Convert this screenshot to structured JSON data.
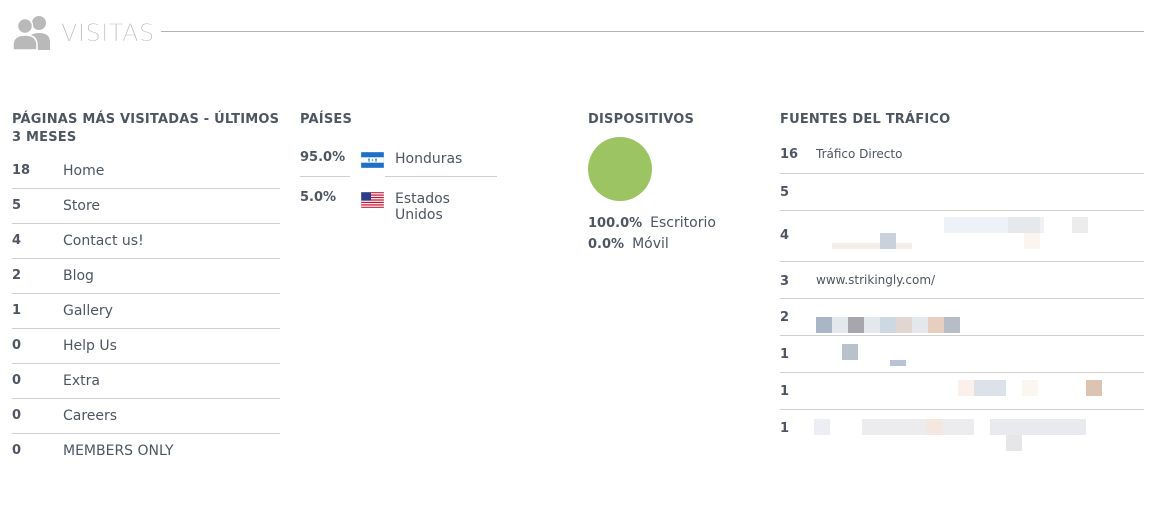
{
  "header": {
    "title": "VISITAS"
  },
  "pages": {
    "title": "PÁGINAS MÁS VISITADAS - ÚLTIMOS 3 MESES",
    "items": [
      {
        "count": "18",
        "name": "Home"
      },
      {
        "count": "5",
        "name": "Store"
      },
      {
        "count": "4",
        "name": "Contact us!"
      },
      {
        "count": "2",
        "name": "Blog"
      },
      {
        "count": "1",
        "name": "Gallery"
      },
      {
        "count": "0",
        "name": "Help Us"
      },
      {
        "count": "0",
        "name": "Extra"
      },
      {
        "count": "0",
        "name": "Careers"
      },
      {
        "count": "0",
        "name": "MEMBERS ONLY"
      }
    ]
  },
  "countries": {
    "title": "PAÍSES",
    "items": [
      {
        "pct": "95.0%",
        "name": "Honduras",
        "flag": "honduras-flag"
      },
      {
        "pct": "5.0%",
        "name": "Estados Unidos",
        "flag": "usa-flag"
      }
    ]
  },
  "devices": {
    "title": "DISPOSITIVOS",
    "items": [
      {
        "pct": "100.0%",
        "name": "Escritorio",
        "fraction": 1.0
      },
      {
        "pct": "0.0%",
        "name": "Móvil",
        "fraction": 0.0
      }
    ],
    "pie_color": "#9dc462"
  },
  "sources": {
    "title": "FUENTES DEL TRÁFICO",
    "items": [
      {
        "count": "16",
        "name": "Tráfico Directo"
      },
      {
        "count": "5",
        "name": ""
      },
      {
        "count": "4",
        "name": ""
      },
      {
        "count": "3",
        "name": "www.strikingly.com/"
      },
      {
        "count": "2",
        "name": ""
      },
      {
        "count": "1",
        "name": ""
      },
      {
        "count": "1",
        "name": ""
      },
      {
        "count": "1",
        "name": ""
      }
    ]
  },
  "colors": {
    "text": "#4d5661",
    "muted": "#b3b3b3",
    "divider": "#d0d0d0",
    "accent_green": "#9dc462"
  }
}
